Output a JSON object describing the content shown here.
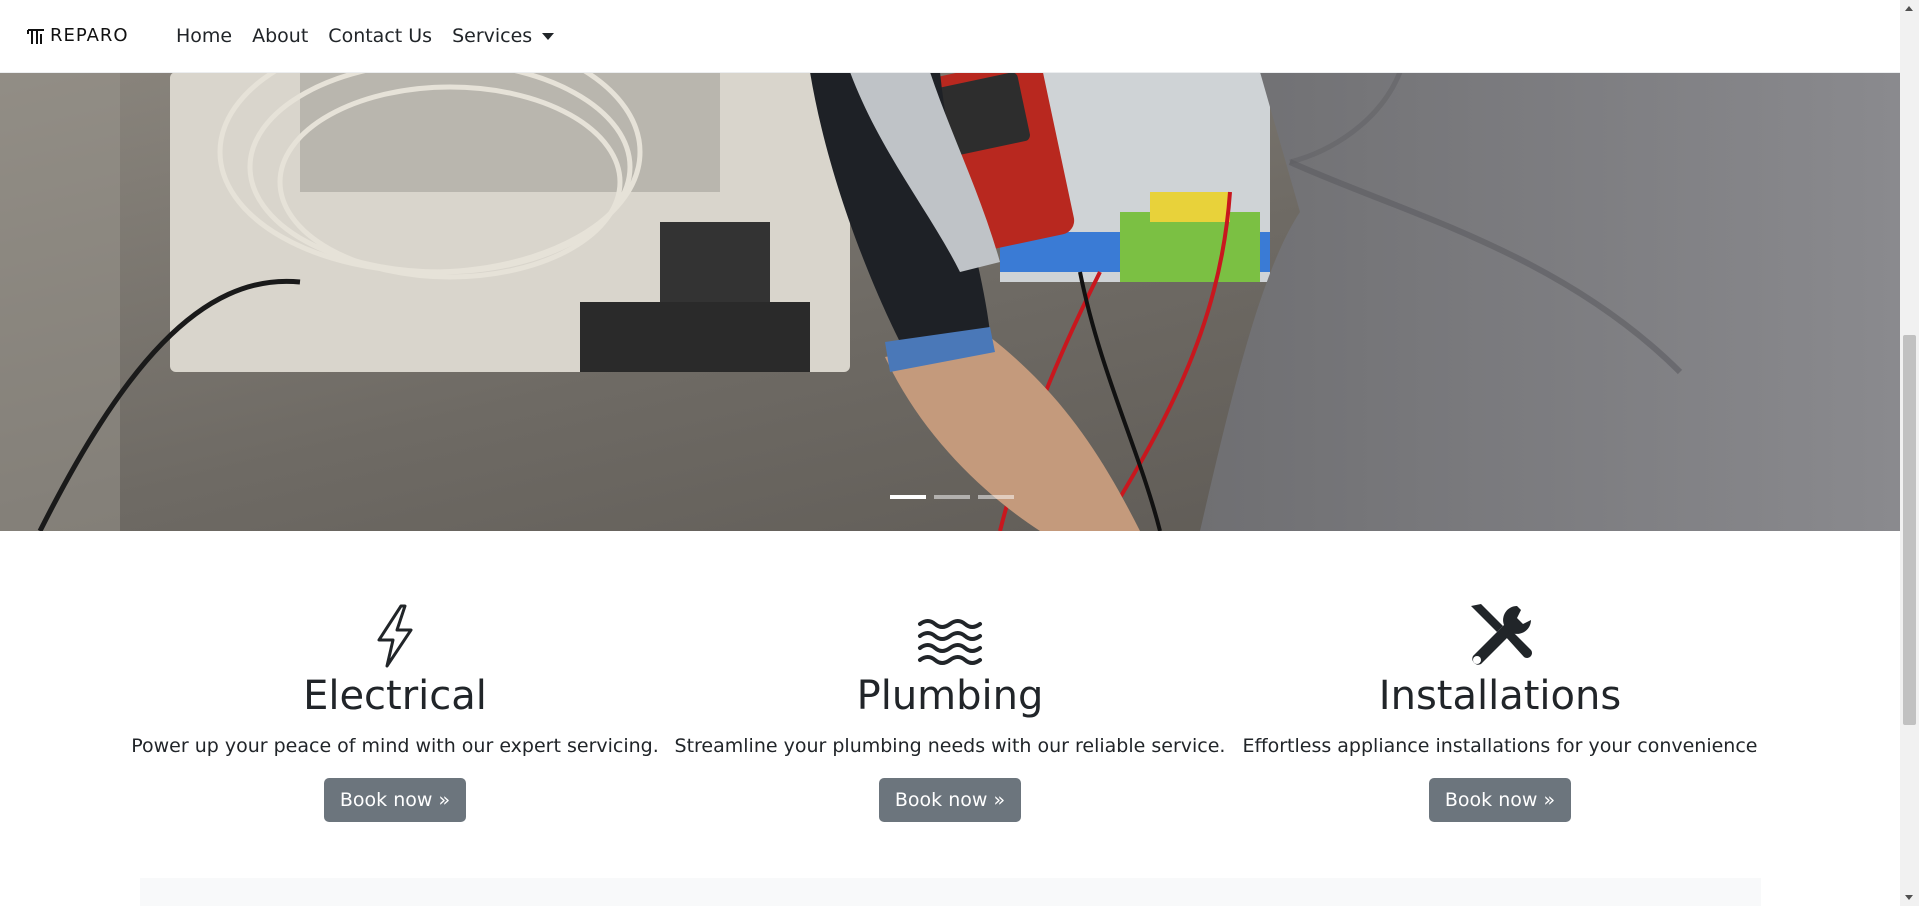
{
  "brand": {
    "text": "REPARO"
  },
  "nav": {
    "items": [
      {
        "label": "Home"
      },
      {
        "label": "About"
      },
      {
        "label": "Contact Us"
      },
      {
        "label": "Services"
      }
    ]
  },
  "carousel": {
    "slides": 3,
    "active_index": 0
  },
  "services": [
    {
      "icon": "lightning-icon",
      "title": "Electrical",
      "text": "Power up your peace of mind with our expert servicing.",
      "button": "Book now »"
    },
    {
      "icon": "waves-icon",
      "title": "Plumbing",
      "text": "Streamline your plumbing needs with our reliable service.",
      "button": "Book now »"
    },
    {
      "icon": "tools-icon",
      "title": "Installations",
      "text": "Effortless appliance installations for your convenience",
      "button": "Book now »"
    }
  ],
  "colors": {
    "button": "#6c757d",
    "text": "#212529",
    "band": "#f8f9fa"
  }
}
